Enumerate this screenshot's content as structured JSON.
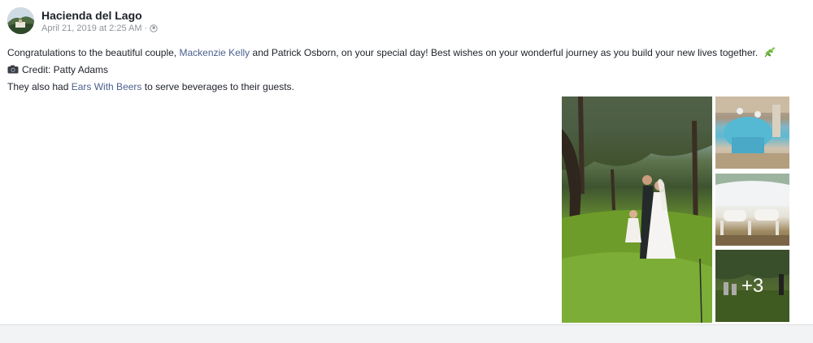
{
  "post": {
    "page_name": "Hacienda del Lago",
    "timestamp": "April 21, 2019 at 2:25 AM",
    "separator": "·",
    "privacy_icon": "globe-icon",
    "text": {
      "line1_before": "Congratulations to the beautiful couple, ",
      "line1_link": "Mackenzie Kelly",
      "line1_after": " and Patrick Osborn, on your special day! Best wishes on your wonderful journey as you build your new lives together.",
      "line1_emoji": "herb-icon",
      "line2_icon": "camera-icon",
      "line2": "Credit: Patty Adams",
      "line3_before": "They also had ",
      "line3_link": "Ears With Beers",
      "line3_after": " to serve beverages to their guests."
    },
    "gallery": {
      "more_count": "+3"
    }
  },
  "colors": {
    "link": "#4b5f8f",
    "meta": "#90949c",
    "text": "#1d2129"
  }
}
